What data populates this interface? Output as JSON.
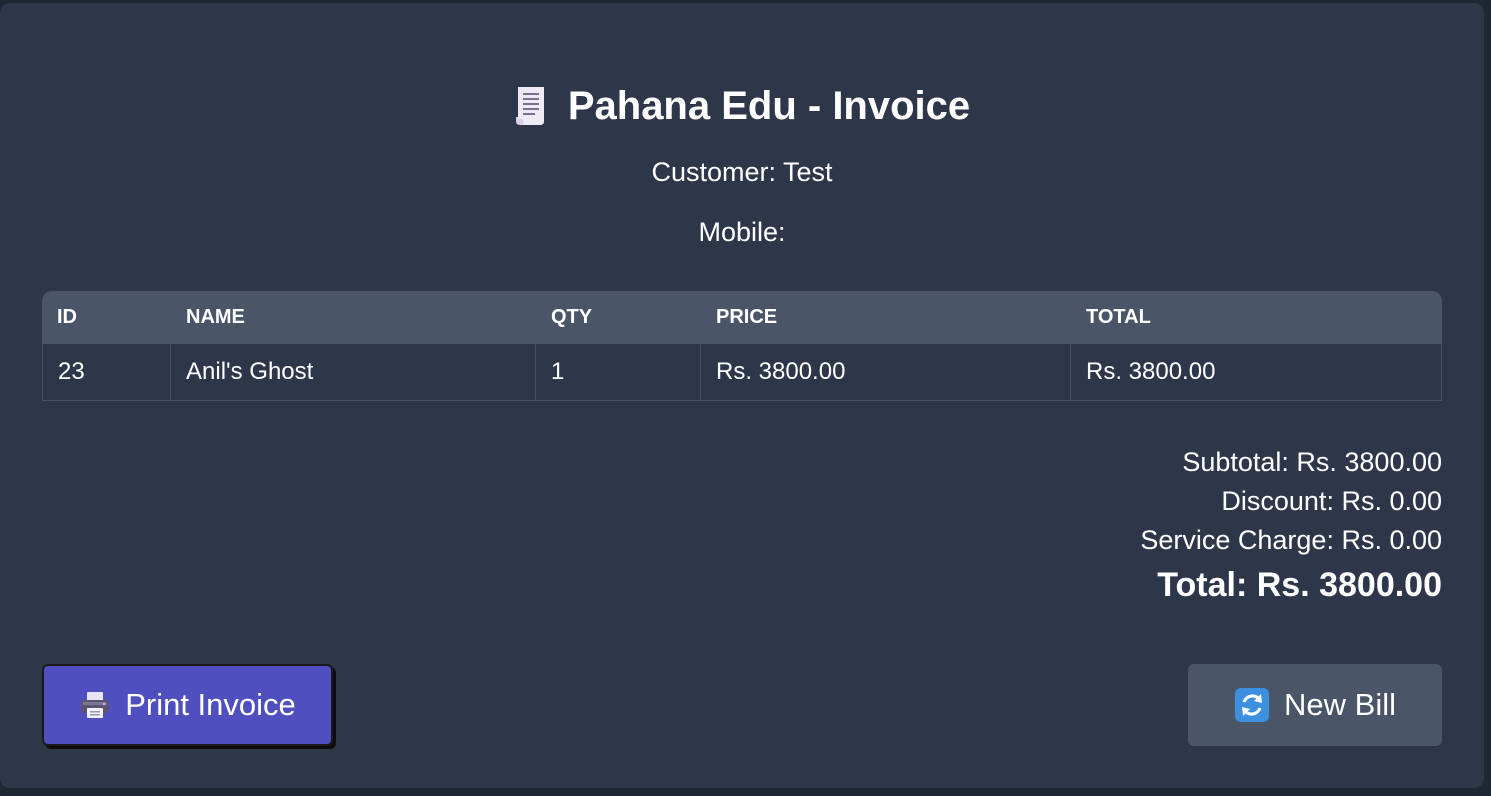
{
  "header": {
    "title": "Pahana Edu - Invoice",
    "icon": "receipt-icon"
  },
  "customer": {
    "label": "Customer: Test",
    "mobile_label": "Mobile:"
  },
  "table": {
    "columns": [
      "ID",
      "NAME",
      "QTY",
      "PRICE",
      "TOTAL"
    ],
    "rows": [
      {
        "id": "23",
        "name": "Anil's Ghost",
        "qty": "1",
        "price": "Rs. 3800.00",
        "total": "Rs. 3800.00"
      }
    ]
  },
  "summary": {
    "subtotal": "Subtotal: Rs. 3800.00",
    "discount": "Discount: Rs. 0.00",
    "service_charge": "Service Charge: Rs. 0.00",
    "total": "Total: Rs. 3800.00"
  },
  "actions": {
    "print_label": "Print Invoice",
    "print_icon": "printer-icon",
    "new_bill_label": "New Bill",
    "new_bill_icon": "refresh-icon"
  },
  "colors": {
    "background": "#2e3749",
    "header_row": "#4a5568",
    "print_button": "#4f4fc0",
    "new_bill_button": "#4a5568"
  }
}
